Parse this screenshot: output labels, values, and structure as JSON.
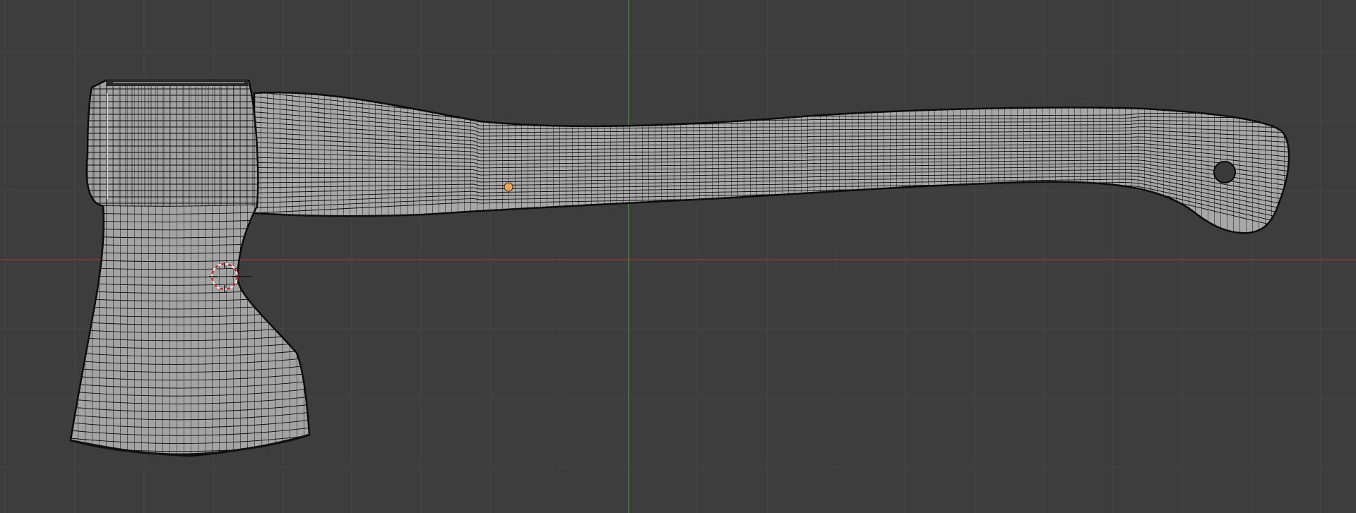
{
  "viewport": {
    "background_color": "#3d3d3d",
    "grid_color": "#474747",
    "x_axis_color": "#8a3a3a",
    "y_axis_color": "#3f8a2c"
  },
  "object": {
    "name": "axe",
    "mesh_fill_color": "#a6a6a6",
    "wire_color": "#0b0b0b",
    "origin_color": "#e8a55a"
  },
  "cursor": {
    "icon": "3d-cursor-icon",
    "ring_color_a": "#e8e8e8",
    "ring_color_b": "#c0282d"
  }
}
